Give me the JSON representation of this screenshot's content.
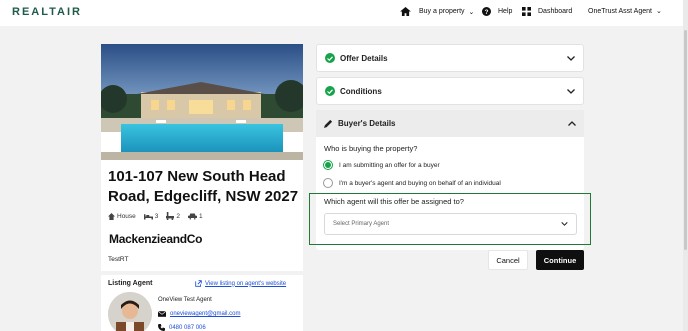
{
  "app": {
    "logo": "REALTAIR"
  },
  "header": {
    "buy_label": "Buy a property",
    "help_label": "Help",
    "dashboard_label": "Dashboard",
    "user_label": "OneTrust Asst Agent"
  },
  "property": {
    "address": "101-107 New South Head Road, Edgecliff, NSW 2027",
    "type": "House",
    "beds": "3",
    "baths": "2",
    "cars": "1",
    "agency": "MackenzieandCo",
    "office": "TestRT"
  },
  "listing": {
    "heading": "Listing Agent",
    "view_link": "View listing on agent's website",
    "agent_name": "OneView Test Agent",
    "agent_email": "oneviewagent@gmail.com",
    "agent_phone": "0480 087 006"
  },
  "sections": {
    "offer_details": "Offer Details",
    "conditions": "Conditions",
    "buyers_details": "Buyer's Details"
  },
  "buyer": {
    "question": "Who is buying the property?",
    "option1": "I am submitting an offer for a buyer",
    "option2": "I'm a buyer's agent and buying on behalf of an individual",
    "selected": "option1",
    "agent_question": "Which agent will this offer be assigned to?",
    "agent_placeholder": "Select Primary Agent"
  },
  "actions": {
    "cancel": "Cancel",
    "continue": "Continue"
  },
  "colors": {
    "accent": "#16a34a",
    "brand": "#1f5a4a",
    "link": "#1d4ed8",
    "highlight_border": "#1e7a35"
  }
}
